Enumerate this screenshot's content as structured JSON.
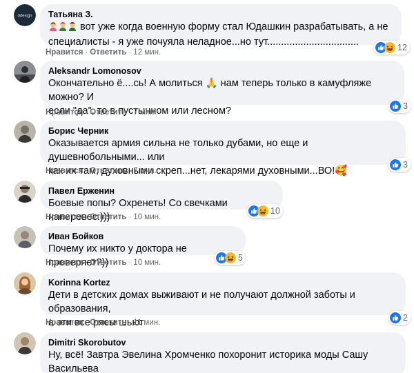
{
  "comments": [
    {
      "author": "Татьяна З.",
      "text_line1": "вот уже когда военную форму стал Юдашкин разрабатывать, а не",
      "text_rest": "специалисты - я уже почуяла неладное...но тут.................................",
      "like": "Нравится",
      "reply": "Ответить",
      "time": "12 мин.",
      "reactions": [
        "like-icon",
        "haha-icon"
      ],
      "count": "12",
      "avatar_label": "ddesign"
    },
    {
      "author": "Aleksandr Lomonosov",
      "text": "Окончательно ё....сь! А молиться 🙏 нам теперь только в камуфляже можно? И\nесли \"да\", то в пустынном или лесном?",
      "like": "Нравится",
      "reply": "Ответить",
      "time": "7 мин.",
      "reactions": [
        "like-icon"
      ],
      "count": "3"
    },
    {
      "author": "Борис Черник",
      "text": "Оказывается армия сильна не только дубами, но еще и душевнобольными... или\nкак их там, духовными скреп...нет, лекарями духовными...ВО!🥰",
      "like": "Нравится",
      "reply": "Ответить",
      "time": "7 мин.",
      "reactions": [
        "like-icon"
      ],
      "count": "3"
    },
    {
      "author": "Павел Ерженин",
      "text": "Боевые попы? Охренеть! Со свечками наперевес:)))",
      "like": "Нравится",
      "reply": "Ответить",
      "time": "10 мин.",
      "reactions": [
        "like-icon",
        "haha-icon"
      ],
      "count": "10"
    },
    {
      "author": "Иван Бойков",
      "text": "Почему их никто у доктора не проверяет?))",
      "like": "Нравится",
      "reply": "Ответить",
      "time": "10 мин.",
      "reactions": [
        "like-icon",
        "haha-icon"
      ],
      "count": "5"
    },
    {
      "author": "Korinna Kortez",
      "text": "Дети в детских домах выживают и не получают должной заботы и образования,\nа эти все рясы шьют",
      "like": "Нравится",
      "reply": "Ответить",
      "time": "11 мин.",
      "reactions": [
        "like-icon"
      ],
      "count": "2"
    },
    {
      "author": "Dimitri Skorobutov",
      "text": "Ну, всё! Завтра Эвелина Хромченко похоронит историка моды Сашу Васильева\n- такого даже он не выдержит...",
      "reactions": []
    }
  ],
  "colors": {
    "bubble": "#f0f2f5",
    "secondary_text": "#65676b",
    "like_blue": "#1877f2",
    "haha_yellow": "#f7b928"
  }
}
